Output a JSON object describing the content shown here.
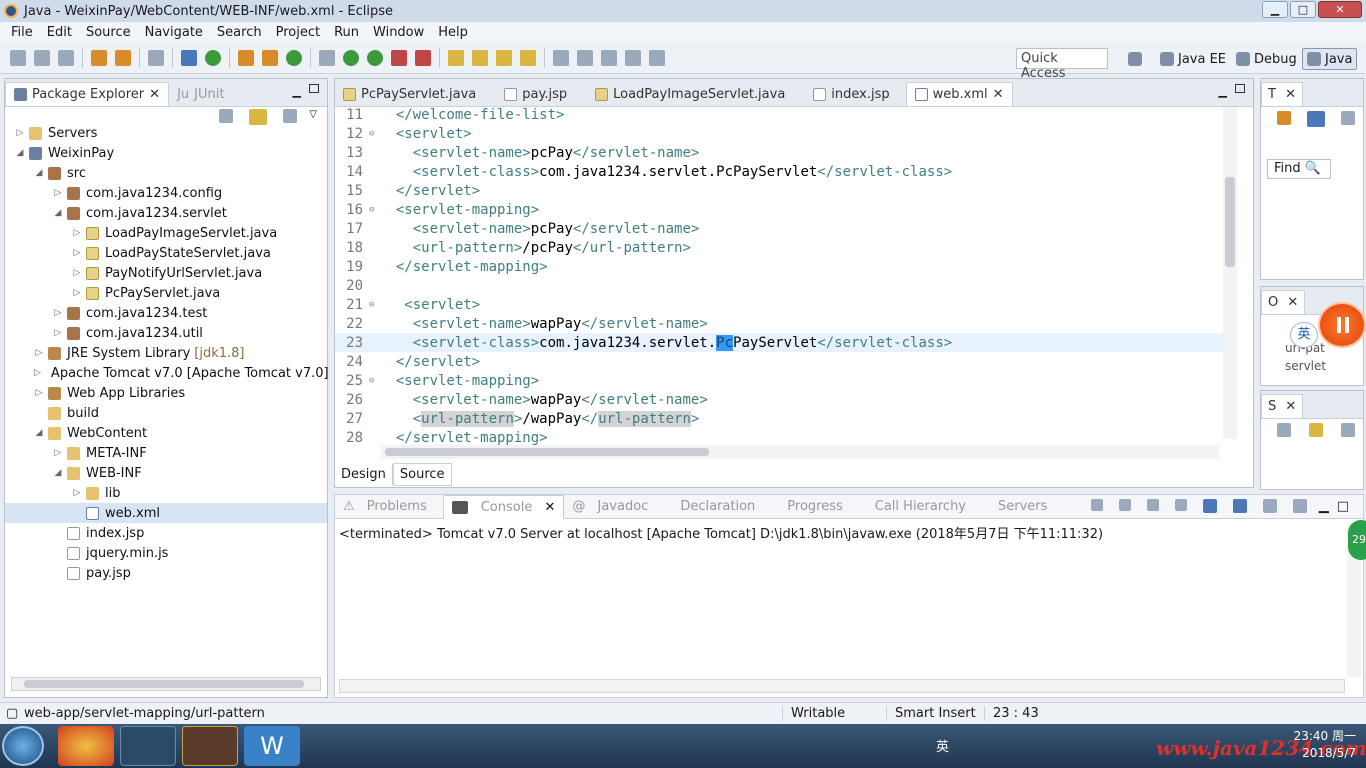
{
  "window": {
    "title": "Java - WeixinPay/WebContent/WEB-INF/web.xml - Eclipse"
  },
  "menu": [
    "File",
    "Edit",
    "Source",
    "Navigate",
    "Search",
    "Project",
    "Run",
    "Window",
    "Help"
  ],
  "toolbar": {
    "quick_access": "Quick Access",
    "perspectives": [
      "Java EE",
      "Debug",
      "Java"
    ]
  },
  "explorer": {
    "tabs": [
      "Package Explorer",
      "JUnit"
    ],
    "tree": [
      {
        "label": "Servers",
        "icon": "folder-icon",
        "arrow": "▷",
        "depth": 0
      },
      {
        "label": "WeixinPay",
        "icon": "project-icon",
        "arrow": "◢",
        "depth": 0
      },
      {
        "label": "src",
        "icon": "source-folder-icon",
        "arrow": "◢",
        "depth": 1
      },
      {
        "label": "com.java1234.config",
        "icon": "package-icon",
        "arrow": "▷",
        "depth": 2
      },
      {
        "label": "com.java1234.servlet",
        "icon": "package-icon",
        "arrow": "◢",
        "depth": 2
      },
      {
        "label": "LoadPayImageServlet.java",
        "icon": "java-file-icon",
        "arrow": "▷",
        "depth": 3
      },
      {
        "label": "LoadPayStateServlet.java",
        "icon": "java-file-icon",
        "arrow": "▷",
        "depth": 3
      },
      {
        "label": "PayNotifyUrlServlet.java",
        "icon": "java-file-icon",
        "arrow": "▷",
        "depth": 3
      },
      {
        "label": "PcPayServlet.java",
        "icon": "java-file-icon",
        "arrow": "▷",
        "depth": 3
      },
      {
        "label": "com.java1234.test",
        "icon": "package-icon",
        "arrow": "▷",
        "depth": 2
      },
      {
        "label": "com.java1234.util",
        "icon": "package-icon",
        "arrow": "▷",
        "depth": 2
      },
      {
        "label": "JRE System Library",
        "decoration": "[jdk1.8]",
        "icon": "library-icon",
        "arrow": "▷",
        "depth": 1
      },
      {
        "label": "Apache Tomcat v7.0 [Apache Tomcat v7.0]",
        "icon": "library-icon",
        "arrow": "▷",
        "depth": 1
      },
      {
        "label": "Web App Libraries",
        "icon": "library-icon",
        "arrow": "▷",
        "depth": 1
      },
      {
        "label": "build",
        "icon": "folder-icon",
        "arrow": "",
        "depth": 1
      },
      {
        "label": "WebContent",
        "icon": "folder-icon",
        "arrow": "◢",
        "depth": 1
      },
      {
        "label": "META-INF",
        "icon": "folder-icon",
        "arrow": "▷",
        "depth": 2
      },
      {
        "label": "WEB-INF",
        "icon": "folder-icon",
        "arrow": "◢",
        "depth": 2
      },
      {
        "label": "lib",
        "icon": "folder-icon",
        "arrow": "▷",
        "depth": 3
      },
      {
        "label": "web.xml",
        "icon": "xml-file-icon",
        "arrow": "",
        "depth": 3,
        "selected": true
      },
      {
        "label": "index.jsp",
        "icon": "jsp-file-icon",
        "arrow": "",
        "depth": 2
      },
      {
        "label": "jquery.min.js",
        "icon": "js-file-icon",
        "arrow": "",
        "depth": 2
      },
      {
        "label": "pay.jsp",
        "icon": "jsp-file-icon",
        "arrow": "",
        "depth": 2
      }
    ]
  },
  "editor": {
    "tabs": [
      "PcPayServlet.java",
      "pay.jsp",
      "LoadPayImageServlet.java",
      "index.jsp",
      "web.xml"
    ],
    "active_tab": "web.xml",
    "lines": [
      {
        "n": "11",
        "indent": "  ",
        "parts": [
          [
            "t",
            "</welcome-file-list>"
          ]
        ]
      },
      {
        "n": "12",
        "fold": "⊖",
        "indent": "  ",
        "parts": [
          [
            "t",
            "<servlet>"
          ]
        ]
      },
      {
        "n": "13",
        "indent": "    ",
        "parts": [
          [
            "t",
            "<servlet-name>"
          ],
          [
            "x",
            "pcPay"
          ],
          [
            "t",
            "</servlet-name>"
          ]
        ]
      },
      {
        "n": "14",
        "indent": "    ",
        "parts": [
          [
            "t",
            "<servlet-class>"
          ],
          [
            "x",
            "com.java1234.servlet.PcPayServlet"
          ],
          [
            "t",
            "</servlet-class>"
          ]
        ]
      },
      {
        "n": "15",
        "indent": "  ",
        "parts": [
          [
            "t",
            "</servlet>"
          ]
        ]
      },
      {
        "n": "16",
        "fold": "⊖",
        "indent": "  ",
        "parts": [
          [
            "t",
            "<servlet-mapping>"
          ]
        ]
      },
      {
        "n": "17",
        "indent": "    ",
        "parts": [
          [
            "t",
            "<servlet-name>"
          ],
          [
            "x",
            "pcPay"
          ],
          [
            "t",
            "</servlet-name>"
          ]
        ]
      },
      {
        "n": "18",
        "indent": "    ",
        "parts": [
          [
            "t",
            "<url-pattern>"
          ],
          [
            "x",
            "/pcPay"
          ],
          [
            "t",
            "</url-pattern>"
          ]
        ]
      },
      {
        "n": "19",
        "indent": "  ",
        "parts": [
          [
            "t",
            "</servlet-mapping>"
          ]
        ]
      },
      {
        "n": "20",
        "indent": "",
        "parts": []
      },
      {
        "n": "21",
        "fold": "⊖",
        "indent": "   ",
        "parts": [
          [
            "t",
            "<servlet>"
          ]
        ]
      },
      {
        "n": "22",
        "indent": "    ",
        "parts": [
          [
            "t",
            "<servlet-name>"
          ],
          [
            "x",
            "wapPay"
          ],
          [
            "t",
            "</servlet-name>"
          ]
        ]
      },
      {
        "n": "23",
        "indent": "    ",
        "current": true,
        "parts": [
          [
            "t",
            "<servlet-class>"
          ],
          [
            "x",
            "com.java1234.servlet."
          ],
          [
            "s",
            "Pc"
          ],
          [
            "x",
            "PayServlet"
          ],
          [
            "t",
            "</servlet-class>"
          ]
        ]
      },
      {
        "n": "24",
        "indent": "  ",
        "parts": [
          [
            "t",
            "</servlet>"
          ]
        ]
      },
      {
        "n": "25",
        "fold": "⊖",
        "indent": "  ",
        "parts": [
          [
            "t",
            "<servlet-mapping>"
          ]
        ]
      },
      {
        "n": "26",
        "indent": "    ",
        "parts": [
          [
            "t",
            "<servlet-name>"
          ],
          [
            "x",
            "wapPay"
          ],
          [
            "t",
            "</servlet-name>"
          ]
        ]
      },
      {
        "n": "27",
        "indent": "    ",
        "parts": [
          [
            "t",
            "<"
          ],
          [
            "h",
            "url-pattern"
          ],
          [
            "t",
            ">"
          ],
          [
            "x",
            "/wapPay"
          ],
          [
            "t",
            "</"
          ],
          [
            "h",
            "url-pattern"
          ],
          [
            "t",
            ">"
          ]
        ]
      },
      {
        "n": "28",
        "indent": "  ",
        "parts": [
          [
            "t",
            "</servlet-mapping>"
          ]
        ]
      }
    ],
    "design_tab": "Design",
    "source_tab": "Source"
  },
  "console": {
    "tabs": [
      "Problems",
      "Console",
      "Javadoc",
      "Declaration",
      "Progress",
      "Call Hierarchy",
      "Servers"
    ],
    "active_tab": "Console",
    "text": "<terminated> Tomcat v7.0 Server at localhost [Apache Tomcat] D:\\jdk1.8\\bin\\javaw.exe (2018年5月7日 下午11:11:32)"
  },
  "right_panels": {
    "outline_tab": "T",
    "find_label": "Find",
    "panel_o": "O",
    "panel_s": "S",
    "partial_texts": [
      "url-pat",
      "servlet"
    ]
  },
  "status": {
    "path": "web-app/servlet-mapping/url-pattern",
    "mode": "Writable",
    "insert": "Smart Insert",
    "position": "23 : 43"
  },
  "taskbar": {
    "ime": "英",
    "watermark": "www.java1234.com",
    "time": "23:40 周一",
    "date": "2018/5/7"
  },
  "overlay": {
    "ime_bubble": "英",
    "badge": "29"
  }
}
